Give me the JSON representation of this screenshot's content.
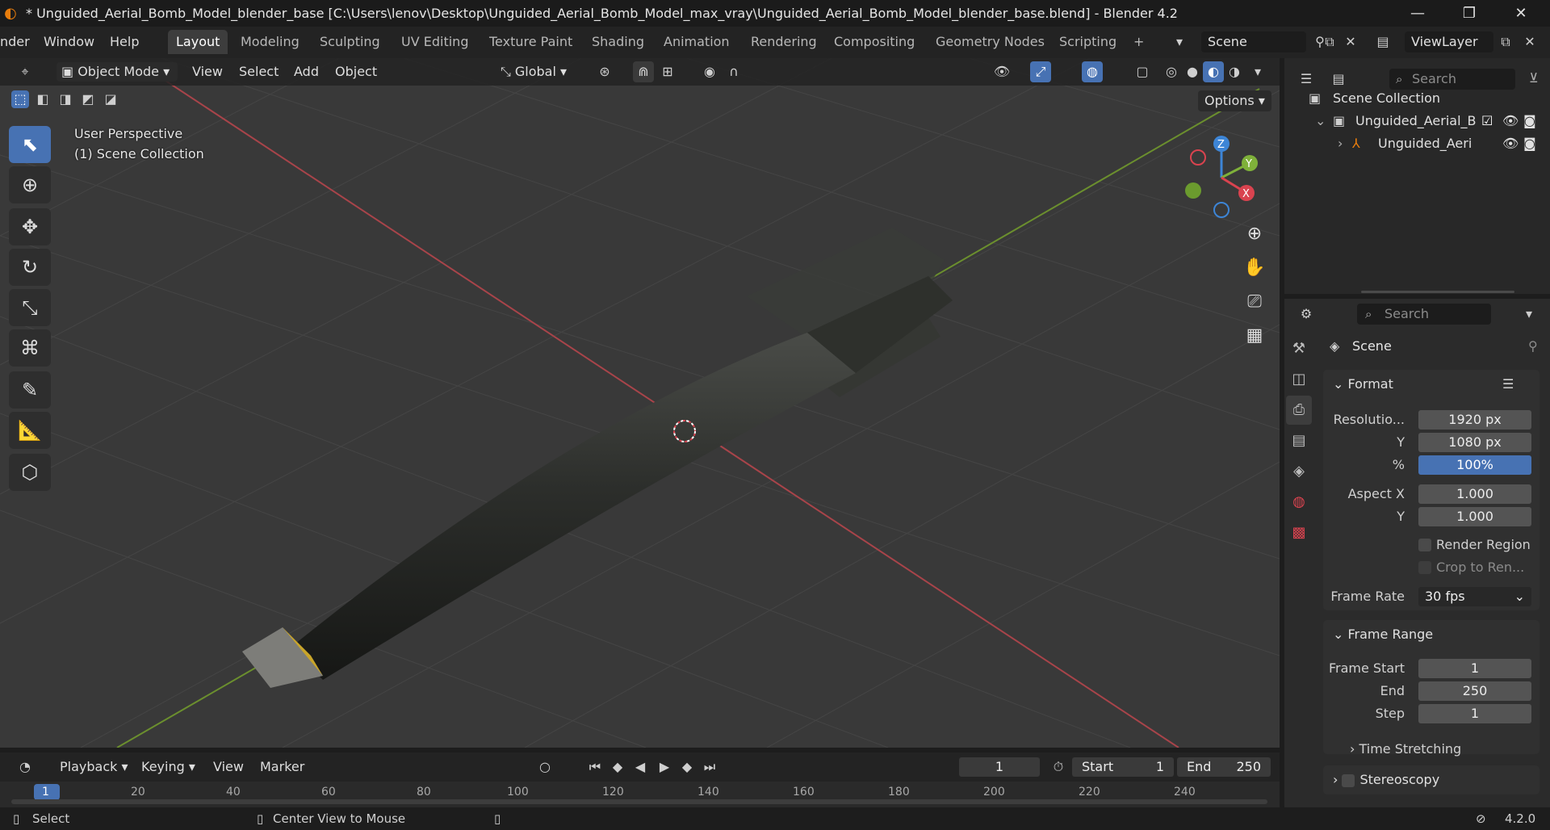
{
  "window": {
    "title": "* Unguided_Aerial_Bomb_Model_blender_base [C:\\Users\\lenov\\Desktop\\Unguided_Aerial_Bomb_Model_max_vray\\Unguided_Aerial_Bomb_Model_blender_base.blend] - Blender 4.2",
    "minimize": "—",
    "maximize": "❐",
    "close": "✕"
  },
  "menu": {
    "render": "nder",
    "window": "Window",
    "help": "Help"
  },
  "workspaces": [
    "Layout",
    "Modeling",
    "Sculpting",
    "UV Editing",
    "Texture Paint",
    "Shading",
    "Animation",
    "Rendering",
    "Compositing",
    "Geometry Nodes",
    "Scripting"
  ],
  "active_workspace": "Layout",
  "add_workspace": "+",
  "scene": {
    "name": "Scene",
    "view_layer": "ViewLayer"
  },
  "viewport": {
    "mode": "Object Mode",
    "menus": [
      "View",
      "Select",
      "Add",
      "Object"
    ],
    "transform": "Global",
    "options": "Options",
    "perspective": "User Perspective",
    "collection": "(1) Scene Collection",
    "gizmo": {
      "z": "Z",
      "y": "Y",
      "x": "X"
    }
  },
  "outliner": {
    "search_placeholder": "Search",
    "root": "Scene Collection",
    "collection": "Unguided_Aerial_B",
    "object": "Unguided_Aeri"
  },
  "properties": {
    "search_placeholder": "Search",
    "context": "Scene",
    "format": {
      "title": "Format",
      "resolution_label": "Resolutio...",
      "res_x": "1920 px",
      "y_label": "Y",
      "res_y": "1080 px",
      "pct_label": "%",
      "pct": "100%",
      "aspect_x_label": "Aspect X",
      "aspect_x": "1.000",
      "aspect_y_label": "Y",
      "aspect_y": "1.000",
      "render_region": "Render Region",
      "crop": "Crop to Ren...",
      "frame_rate_label": "Frame Rate",
      "frame_rate": "30 fps"
    },
    "frame_range": {
      "title": "Frame Range",
      "start_label": "Frame Start",
      "start": "1",
      "end_label": "End",
      "end": "250",
      "step_label": "Step",
      "step": "1"
    },
    "time_stretching": "Time Stretching",
    "stereoscopy": "Stereoscopy"
  },
  "timeline": {
    "menus": [
      "Playback",
      "Keying",
      "View",
      "Marker"
    ],
    "current_frame": "1",
    "start_label": "Start",
    "start": "1",
    "end_label": "End",
    "end": "250",
    "ticks": [
      "1",
      "20",
      "40",
      "60",
      "80",
      "100",
      "120",
      "140",
      "160",
      "180",
      "200",
      "220",
      "240"
    ]
  },
  "status": {
    "select": "Select",
    "center": "Center View to Mouse",
    "version": "4.2.0"
  },
  "colors": {
    "accent": "#4772b3",
    "brand": "#e87d0d",
    "x_axis": "#d9434f",
    "y_axis": "#7fb13a",
    "z_axis": "#3d85d6"
  }
}
